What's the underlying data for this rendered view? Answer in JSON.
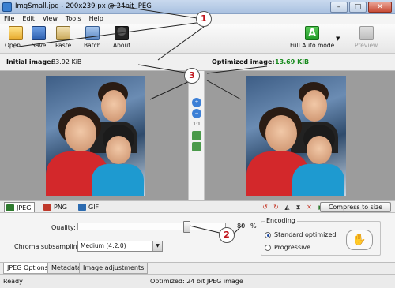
{
  "window": {
    "title": "ImgSmall.jpg - 200x239 px @ 24bit JPEG"
  },
  "menu": [
    "File",
    "Edit",
    "View",
    "Tools",
    "Help"
  ],
  "toolbar": {
    "open": "Open...",
    "save": "Save",
    "paste": "Paste",
    "batch": "Batch",
    "about": "About",
    "full_auto": "Full Auto mode",
    "full_auto_letter": "A",
    "preview": "Preview"
  },
  "info": {
    "initial_label": "Initial image:",
    "initial_size": "83.92 KiB",
    "optimized_label": "Optimized image:",
    "optimized_size": "13.69 KiB"
  },
  "side_tools": [
    "zoom-in-icon",
    "zoom-out-icon",
    "1:1",
    "fit-icon",
    "swap-icon"
  ],
  "format_tabs": [
    "JPEG",
    "PNG",
    "GIF"
  ],
  "compress_button": "Compress to size",
  "options": {
    "quality_label": "Quality:",
    "quality_value": "80",
    "quality_unit": "%",
    "quality_fraction": 0.8,
    "chroma_label": "Chroma subsampling:",
    "chroma_value": "Medium (4:2:0)",
    "encoding_label": "Encoding",
    "encoding_options": [
      "Standard optimized",
      "Progressive"
    ],
    "encoding_selected": "Standard optimized"
  },
  "bottom_tabs": [
    "JPEG Options",
    "Metadata",
    "Image adjustments"
  ],
  "status": {
    "ready": "Ready",
    "message": "Optimized: 24 bit JPEG image"
  },
  "callouts": [
    "1",
    "2",
    "3"
  ],
  "colors": {
    "optimized_size": "#168a1c",
    "callout_text": "#c0141b",
    "full_auto": "#1f9a26"
  }
}
